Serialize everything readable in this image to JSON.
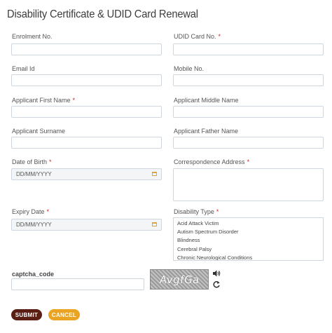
{
  "title": "Disability Certificate & UDID Card Renewal",
  "fields": {
    "enrolment_no": {
      "label": "Enrolment No.",
      "required": false,
      "value": ""
    },
    "udid_card_no": {
      "label": "UDID Card No.",
      "required": true,
      "value": ""
    },
    "email_id": {
      "label": "Email Id",
      "required": false,
      "value": ""
    },
    "mobile_no": {
      "label": "Mobile No.",
      "required": false,
      "value": ""
    },
    "first_name": {
      "label": "Applicant First Name",
      "required": true,
      "value": ""
    },
    "middle_name": {
      "label": "Applicant Middle Name",
      "required": false,
      "value": ""
    },
    "surname": {
      "label": "Applicant Surname",
      "required": false,
      "value": ""
    },
    "father_name": {
      "label": "Applicant Father Name",
      "required": false,
      "value": ""
    },
    "dob": {
      "label": "Date of Birth",
      "required": true,
      "value": "DD/MM/YYYY"
    },
    "address": {
      "label": "Correspondence Address",
      "required": true,
      "value": ""
    },
    "expiry_date": {
      "label": "Expiry Date",
      "required": true,
      "value": "DD/MM/YYYY"
    },
    "disability_type": {
      "label": "Disability Type",
      "required": true,
      "options": [
        "Acid Attack Victim",
        "Autism Spectrum Disorder",
        "Blindness",
        "Cerebral Palsy",
        "Chronic Neurological Conditions"
      ]
    }
  },
  "required_mark": "*",
  "captcha": {
    "label": "captcha_code",
    "value": "",
    "image_text": "AvgfGa"
  },
  "buttons": {
    "submit": "SUBMIT",
    "cancel": "CANCEL"
  },
  "icons": {
    "calendar": "calendar-icon",
    "audio": "speaker-icon",
    "refresh": "refresh-icon"
  },
  "colors": {
    "submit_bg": "#5a1e12",
    "cancel_bg": "#eaa422",
    "required": "#c62828",
    "calendar": "#e0a339"
  }
}
